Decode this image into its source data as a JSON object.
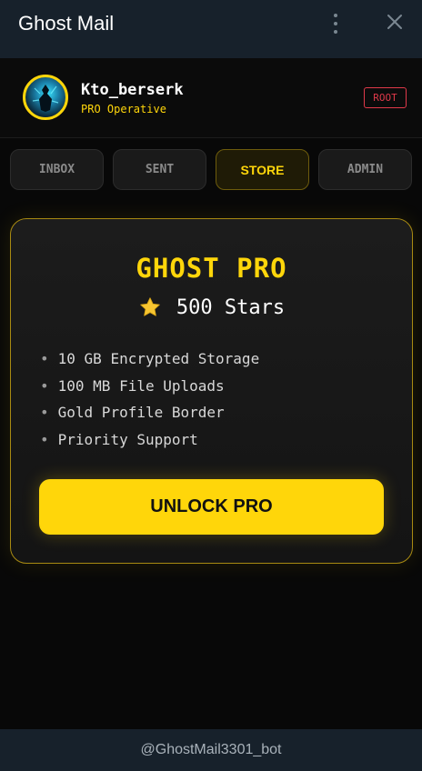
{
  "window": {
    "title": "Ghost Mail",
    "menu_icon": "more-vertical-icon",
    "close_icon": "close-icon"
  },
  "profile": {
    "username": "Kto_berserk",
    "rank": "PRO Operative",
    "badge": "ROOT",
    "avatar_border_color": "#ffd60a"
  },
  "tabs": [
    {
      "label": "INBOX",
      "active": false
    },
    {
      "label": "SENT",
      "active": false
    },
    {
      "label": "STORE",
      "active": true
    },
    {
      "label": "ADMIN",
      "active": false
    }
  ],
  "store": {
    "title": "GHOST PRO",
    "price": "500 Stars",
    "price_icon": "star-icon",
    "features": [
      "10 GB Encrypted Storage",
      "100 MB File Uploads",
      "Gold Profile Border",
      "Priority Support"
    ],
    "bullet": "•",
    "button_label": "UNLOCK PRO"
  },
  "footer": {
    "bot_handle": "@GhostMail3301_bot"
  },
  "colors": {
    "accent": "#ffd60a",
    "danger": "#e0394a",
    "chrome": "#17212b",
    "background": "#080808"
  }
}
